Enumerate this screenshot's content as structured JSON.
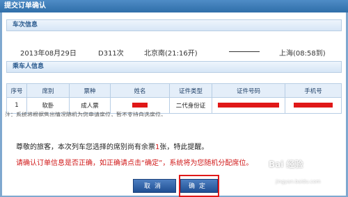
{
  "window": {
    "title": "提交订单确认"
  },
  "train_section": {
    "header": "车次信息"
  },
  "train": {
    "date": "2013年08月29日",
    "number": "D311次",
    "from": "北京南(21:16开)",
    "to": "上海(08:58到)"
  },
  "passenger_section": {
    "header": "乘车人信息"
  },
  "table": {
    "columns": [
      "序号",
      "席别",
      "票种",
      "姓名",
      "证件类型",
      "证件号码",
      "手机号"
    ],
    "rows": [
      {
        "index": "1",
        "seat": "软卧",
        "ticket_type": "成人票",
        "name": "",
        "id_type": "二代身份证",
        "id_number": "",
        "phone": ""
      }
    ]
  },
  "note": "注：系统将根据售出情况随机为您申请席位，暂不支持自选席位。",
  "message": {
    "line1_prefix": "尊敬的旅客，本次列车您选择的席别尚有余票",
    "line1_count": "1",
    "line1_suffix": "张，特此提醒。",
    "line2": "请确认订单信息是否正确，如正确请点击“确定”，系统将为您随机分配席位。"
  },
  "buttons": {
    "cancel": "取消",
    "confirm": "确定"
  },
  "watermark": {
    "text": "Bai 经验",
    "sub": "jingyan.baidu.com"
  },
  "colors": {
    "accent": "#2f6ea9",
    "alert": "#d01818",
    "redaction": "#e01818"
  }
}
